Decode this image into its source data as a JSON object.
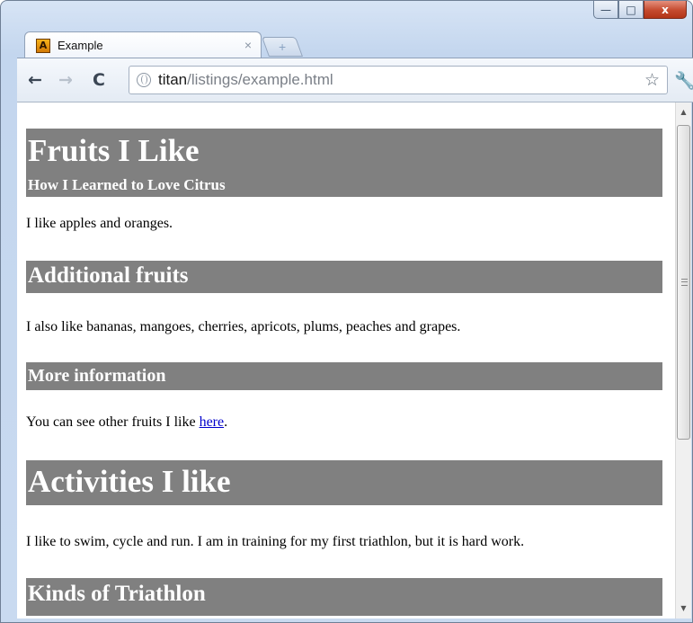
{
  "browser": {
    "tab_title": "Example",
    "tab_close": "×",
    "new_tab": "+",
    "favicon_letter": "A",
    "url_host": "titan",
    "url_path": "/listings/example.html",
    "back": "←",
    "forward": "→",
    "reload": "C",
    "bookmark": "☆",
    "wrench": "🔧",
    "min": "—",
    "max": "□",
    "close": "x"
  },
  "page": {
    "h1": "Fruits I Like",
    "subtitle": "How I Learned to Love Citrus",
    "p1": "I like apples and oranges.",
    "h2": "Additional fruits",
    "p2": "I also like bananas, mangoes, cherries, apricots, plums, peaches and grapes.",
    "h3": "More information",
    "p3_before": "You can see other fruits I like ",
    "p3_link": "here",
    "p3_after": ".",
    "h1b": "Activities I like",
    "p4": "I like to swim, cycle and run. I am in training for my first triathlon, but it is hard work.",
    "h2b": "Kinds of Triathlon"
  },
  "colors": {
    "heading_bg": "#808080",
    "heading_text": "#ffffff",
    "link": "#0000cc"
  }
}
